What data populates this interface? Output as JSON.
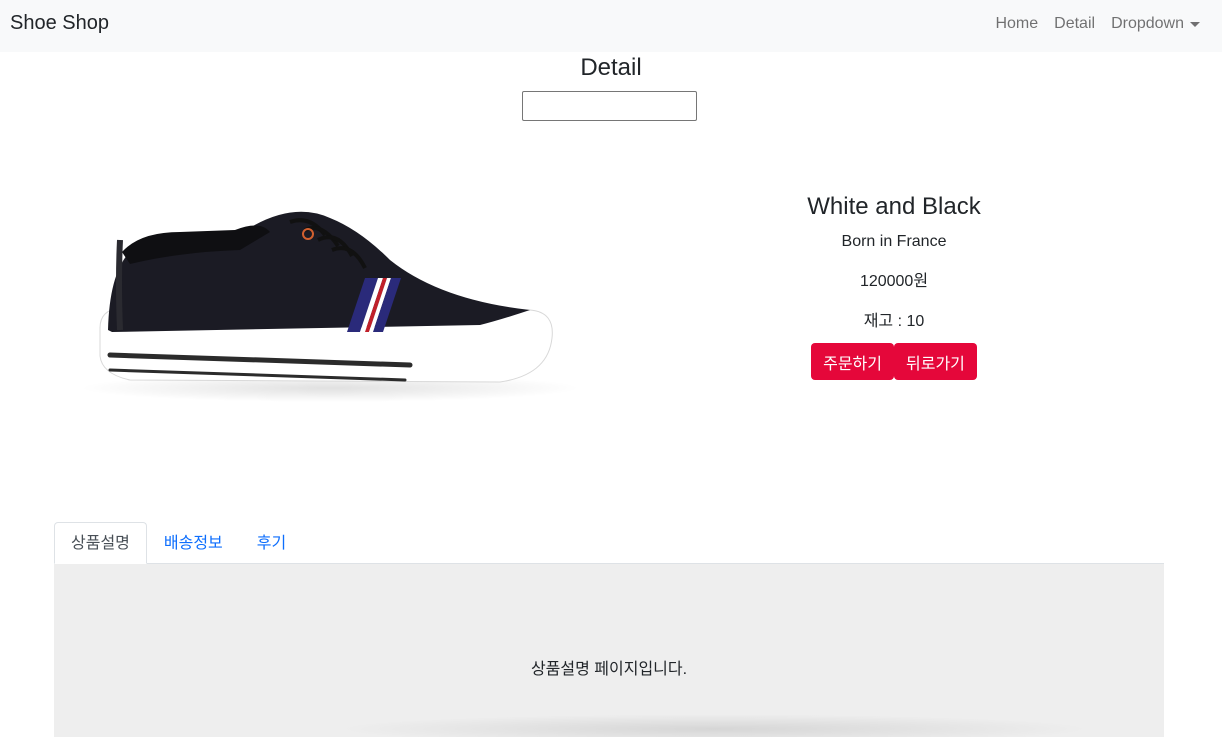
{
  "navbar": {
    "brand": "Shoe Shop",
    "links": [
      "Home",
      "Detail"
    ],
    "dropdown_label": "Dropdown"
  },
  "page": {
    "title": "Detail",
    "input_value": ""
  },
  "product": {
    "name": "White and Black",
    "origin": "Born in France",
    "price": "120000원",
    "stock": "재고 : 10",
    "order_button": "주문하기",
    "back_button": "뒤로가기"
  },
  "tabs": {
    "items": [
      "상품설명",
      "배송정보",
      "후기"
    ],
    "active_index": 0,
    "content_text": "상품설명 페이지입니다."
  },
  "colors": {
    "accent": "#e5073a",
    "link": "#0d6efd",
    "navbar_bg": "#f8f9fa",
    "content_bg": "#eeeeee"
  }
}
